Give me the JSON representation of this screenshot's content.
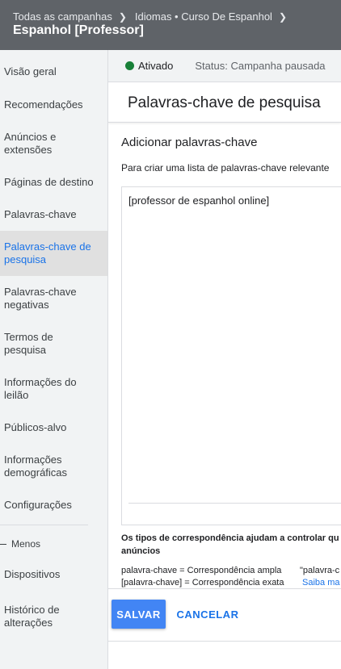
{
  "header": {
    "breadcrumbs": [
      "Todas as campanhas",
      "Idiomas • Curso De Espanhol"
    ],
    "title": "Espanhol [Professor]"
  },
  "sidebar": {
    "items": [
      {
        "label": "Visão geral"
      },
      {
        "label": "Recomendações"
      },
      {
        "label": "Anúncios e extensões"
      },
      {
        "label": "Páginas de destino"
      },
      {
        "label": "Palavras-chave"
      },
      {
        "label": "Palavras-chave de pesquisa",
        "active": true
      },
      {
        "label": "Palavras-chave negativas"
      },
      {
        "label": "Termos de pesquisa"
      },
      {
        "label": "Informações do leilão"
      },
      {
        "label": "Públicos-alvo"
      },
      {
        "label": "Informações demográficas"
      },
      {
        "label": "Configurações"
      }
    ],
    "menos_label": "Menos",
    "extra_items": [
      {
        "label": "Dispositivos"
      },
      {
        "label": "Histórico de alterações"
      }
    ]
  },
  "status": {
    "enabled_label": "Ativado",
    "status_text": "Status: Campanha pausada",
    "enabled_color": "#188038"
  },
  "main": {
    "page_title": "Palavras-chave de pesquisa",
    "section_title": "Adicionar palavras-chave",
    "helper_text": "Para criar uma lista de palavras-chave relevante",
    "keyword_value": "[professor de espanhol online]",
    "match_types_info": "Os tipos de correspondência ajudam a controlar qu anúncios",
    "match_broad": "palavra-chave = Correspondência ampla",
    "match_phrase_partial": "\"palavra-c",
    "match_exact": "[palavra-chave] = Correspondência exata",
    "learn_more": "Saiba ma"
  },
  "actions": {
    "save_label": "SALVAR",
    "cancel_label": "CANCELAR",
    "accent_color": "#4285f4"
  }
}
